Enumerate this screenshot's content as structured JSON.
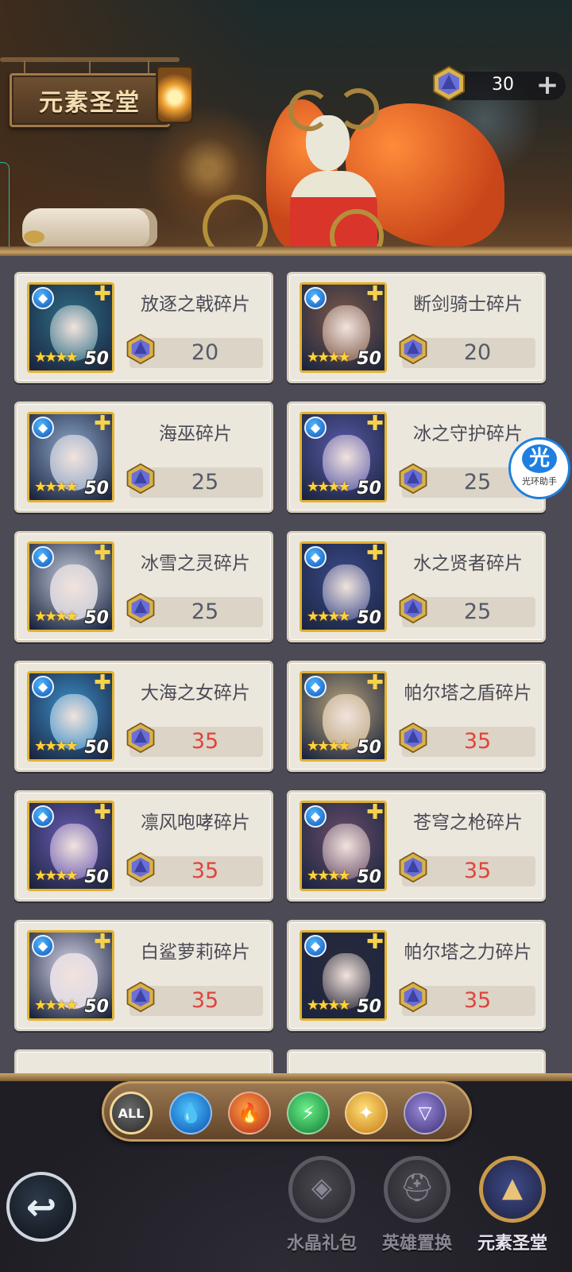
{
  "header": {
    "title": "元素圣堂",
    "currency": {
      "amount": "30",
      "plus": "+",
      "icon": "crystal-gem-icon"
    }
  },
  "assistant": {
    "glyph": "光",
    "label": "光环助手"
  },
  "colors": {
    "price_affordable": "#55596a",
    "price_unaffordable": "#e0443c",
    "frame_gold": "#e2b230",
    "water_element": "#1356b8"
  },
  "shop": {
    "items": [
      {
        "name": "放逐之戟碎片",
        "price": "20",
        "affordable": true,
        "stars": "★★★★",
        "level": "50",
        "element": "water",
        "tint": "#2e6f86"
      },
      {
        "name": "断剑骑士碎片",
        "price": "20",
        "affordable": true,
        "stars": "★★★★",
        "level": "50",
        "element": "water",
        "tint": "#7e5a4a"
      },
      {
        "name": "海巫碎片",
        "price": "25",
        "affordable": true,
        "stars": "★★★★",
        "level": "50",
        "element": "water",
        "tint": "#8ea6c8"
      },
      {
        "name": "冰之守护碎片",
        "price": "25",
        "affordable": true,
        "stars": "★★★★",
        "level": "50",
        "element": "water",
        "tint": "#5a5aa8"
      },
      {
        "name": "冰雪之灵碎片",
        "price": "25",
        "affordable": true,
        "stars": "★★★★",
        "level": "50",
        "element": "water",
        "tint": "#c2c8d8"
      },
      {
        "name": "水之贤者碎片",
        "price": "25",
        "affordable": true,
        "stars": "★★★★",
        "level": "50",
        "element": "water",
        "tint": "#3a4a8a"
      },
      {
        "name": "大海之女碎片",
        "price": "35",
        "affordable": false,
        "stars": "★★★★",
        "level": "50",
        "element": "water",
        "tint": "#3b8ec8"
      },
      {
        "name": "帕尔塔之盾碎片",
        "price": "35",
        "affordable": false,
        "stars": "★★★★",
        "level": "50",
        "element": "water",
        "tint": "#b9a47a"
      },
      {
        "name": "凛风咆哮碎片",
        "price": "35",
        "affordable": false,
        "stars": "★★★★",
        "level": "50",
        "element": "water",
        "tint": "#6a5ab2"
      },
      {
        "name": "苍穹之枪碎片",
        "price": "35",
        "affordable": false,
        "stars": "★★★★",
        "level": "50",
        "element": "water",
        "tint": "#6a4e6a"
      },
      {
        "name": "白鲨萝莉碎片",
        "price": "35",
        "affordable": false,
        "stars": "★★★★",
        "level": "50",
        "element": "water",
        "tint": "#d8d6e8"
      },
      {
        "name": "帕尔塔之力碎片",
        "price": "35",
        "affordable": false,
        "stars": "★★★★",
        "level": "50",
        "element": "water",
        "tint": "#2a2a3a"
      }
    ]
  },
  "filters": [
    {
      "id": "all",
      "label": "ALL",
      "icon": "all-filter-icon",
      "glyph": "ALL"
    },
    {
      "id": "water",
      "icon": "water-element-icon",
      "glyph": "💧"
    },
    {
      "id": "fire",
      "icon": "fire-element-icon",
      "glyph": "🔥"
    },
    {
      "id": "wind",
      "icon": "wind-element-icon",
      "glyph": "⚡"
    },
    {
      "id": "light",
      "icon": "light-element-icon",
      "glyph": "✦"
    },
    {
      "id": "dark",
      "icon": "dark-element-icon",
      "glyph": "▽"
    }
  ],
  "nav": {
    "back_icon": "back-arrow-icon",
    "back_glyph": "↩",
    "tabs": [
      {
        "label": "水晶礼包",
        "active": false,
        "glyph": "◈"
      },
      {
        "label": "英雄置换",
        "active": false,
        "glyph": "⛑"
      },
      {
        "label": "元素圣堂",
        "active": true,
        "glyph": "▲"
      }
    ]
  }
}
